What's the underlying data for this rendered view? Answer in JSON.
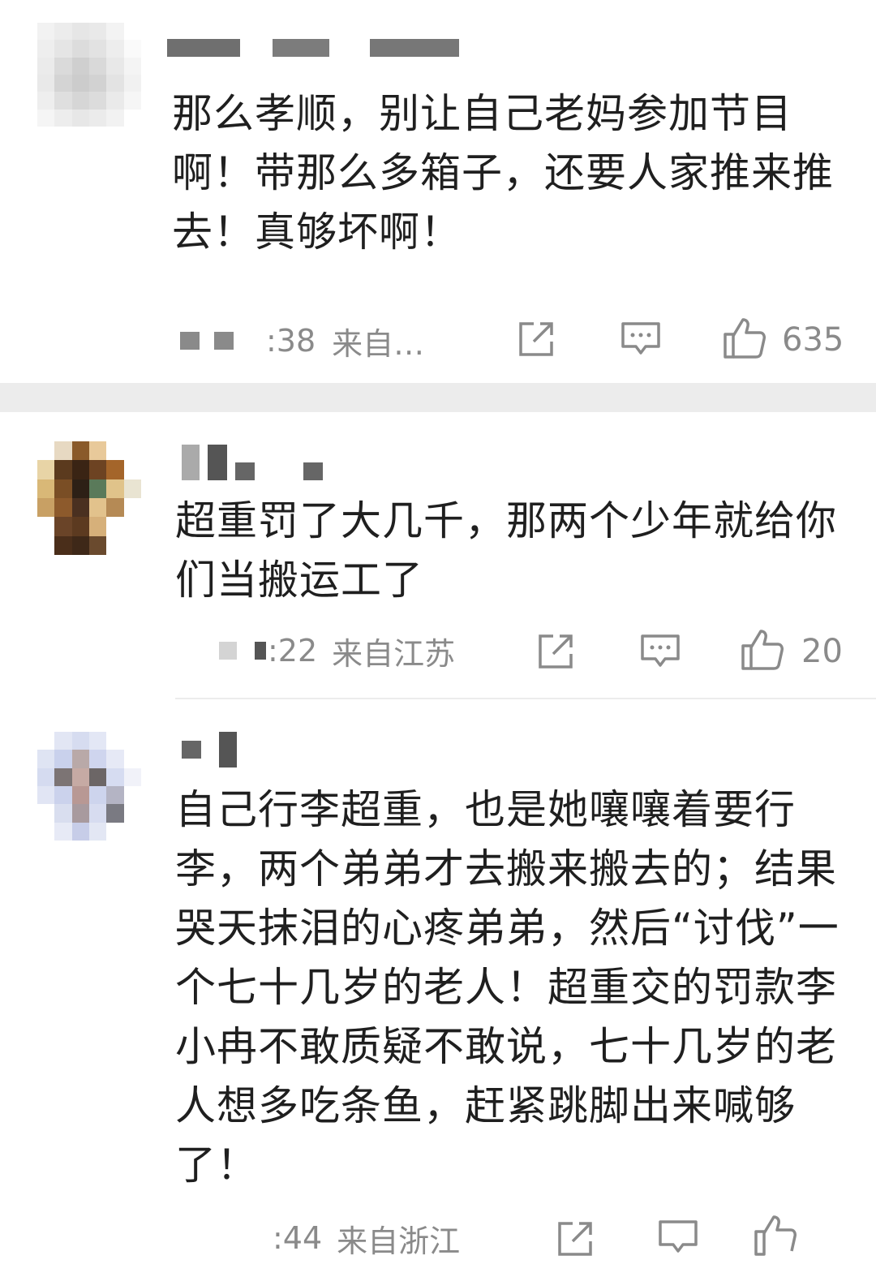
{
  "comments": [
    {
      "text": "那么孝顺，别让自己老妈参加节目啊！带那么多箱子，还要人家推来推去！真够坏啊！",
      "time": ":38",
      "location": "来自…",
      "likes": "635"
    },
    {
      "text": "超重罚了大几千，那两个少年就给你们当搬运工了",
      "time": ":22",
      "location": "来自江苏",
      "likes": "20"
    },
    {
      "text": "自己行李超重，也是她嚷嚷着要行李，两个弟弟才去搬来搬去的；结果哭天抹泪的心疼弟弟，然后“讨伐”一个七十几岁的老人！超重交的罚款李小冉不敢质疑不敢说，七十几岁的老人想多吃条鱼，赶紧跳脚出来喊够了！",
      "time": ":44",
      "location": "来自浙江",
      "likes": ""
    }
  ],
  "icons": {
    "share": "share-icon",
    "reply": "comment-icon",
    "like": "thumbs-up-icon"
  },
  "colors": {
    "text": "#1f1f1f",
    "meta": "#8a8a8a",
    "separator": "#ececec"
  }
}
